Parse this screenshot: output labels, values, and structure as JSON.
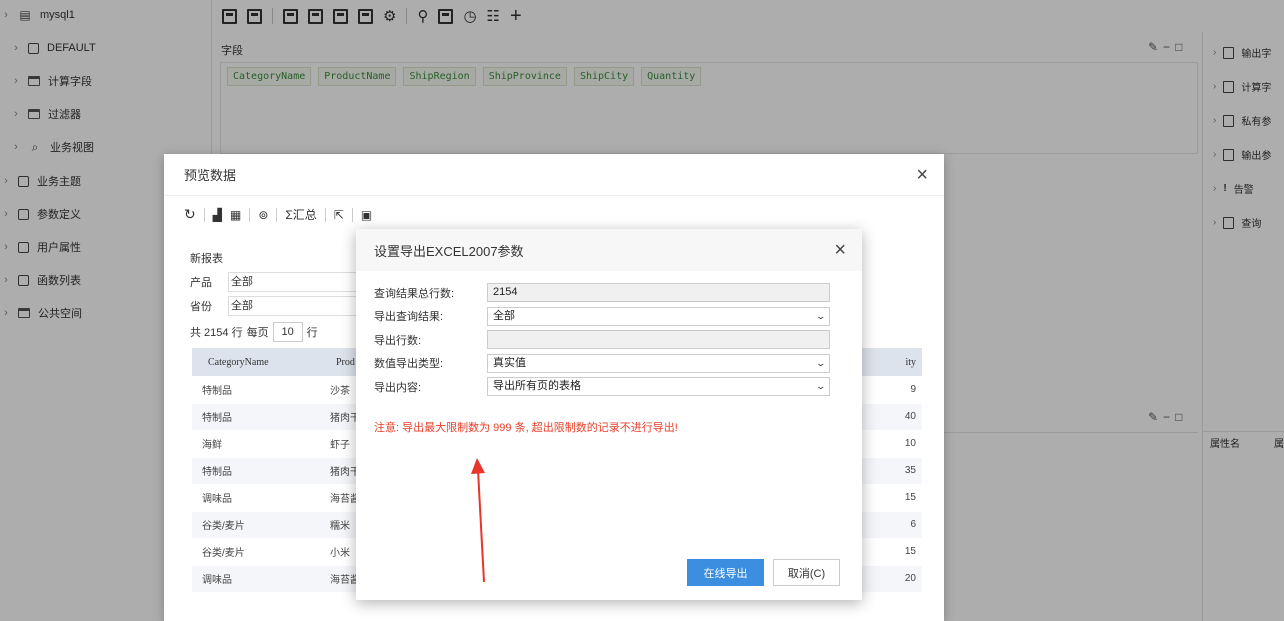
{
  "left_tree": {
    "items": [
      {
        "label": "mysql1",
        "icon": "database-icon"
      },
      {
        "label": "DEFAULT",
        "icon": "schema-icon"
      },
      {
        "label": "计算字段",
        "icon": "folder-icon"
      },
      {
        "label": "过滤器",
        "icon": "folder-icon"
      },
      {
        "label": "业务视图",
        "icon": "search-icon"
      },
      {
        "label": "业务主题",
        "icon": "theme-icon"
      },
      {
        "label": "参数定义",
        "icon": "param-icon"
      },
      {
        "label": "用户属性",
        "icon": "user-attr-icon"
      },
      {
        "label": "函数列表",
        "icon": "function-icon"
      },
      {
        "label": "公共空间",
        "icon": "folder-icon"
      }
    ]
  },
  "fields_section": {
    "label": "字段",
    "fields": [
      "CategoryName",
      "ProductName",
      "ShipRegion",
      "ShipProvince",
      "ShipCity",
      "Quantity"
    ]
  },
  "right_panel": {
    "items": [
      "输出字",
      "计算字",
      "私有参",
      "输出参",
      "告警",
      "查询"
    ],
    "property_header": [
      "属性名",
      "属"
    ]
  },
  "preview": {
    "title": "预览数据",
    "close": "×",
    "tool_sum": "Σ汇总",
    "report_name": "新报表",
    "filters": [
      {
        "label": "产品",
        "value": "全部"
      },
      {
        "label": "省份",
        "value": "全部"
      }
    ],
    "pager": {
      "total": "共 2154 行",
      "per_page": "每页",
      "size": "10",
      "unit": "行"
    },
    "columns": [
      "CategoryName",
      "Prod",
      "ity"
    ],
    "rows": [
      {
        "cat": "特制品",
        "prod": "沙茶",
        "qty": "9"
      },
      {
        "cat": "特制品",
        "prod": "猪肉干",
        "qty": "40"
      },
      {
        "cat": "海鲜",
        "prod": "虾子",
        "qty": "10"
      },
      {
        "cat": "特制品",
        "prod": "猪肉干",
        "qty": "35"
      },
      {
        "cat": "调味品",
        "prod": "海苔酱",
        "qty": "15"
      },
      {
        "cat": "谷类/麦片",
        "prod": "糯米",
        "qty": "6"
      },
      {
        "cat": "谷类/麦片",
        "prod": "小米",
        "qty": "15"
      },
      {
        "cat": "调味品",
        "prod": "海苔酱",
        "qty": "20"
      }
    ]
  },
  "export_dialog": {
    "title": "设置导出EXCEL2007参数",
    "close": "×",
    "fields": {
      "total_rows_label": "查询结果总行数:",
      "total_rows_value": "2154",
      "export_result_label": "导出查询结果:",
      "export_result_value": "全部",
      "export_rows_label": "导出行数:",
      "export_rows_value": "",
      "value_type_label": "数值导出类型:",
      "value_type_value": "真实值",
      "content_label": "导出内容:",
      "content_value": "导出所有页的表格"
    },
    "note": "注意: 导出最大限制数为 999 条, 超出限制数的记录不进行导出!",
    "buttons": {
      "primary": "在线导出",
      "cancel": "取消(C)"
    }
  },
  "colors": {
    "accent": "#3c8fe0",
    "warning": "#e8412c",
    "arrow": "#e8352a"
  }
}
